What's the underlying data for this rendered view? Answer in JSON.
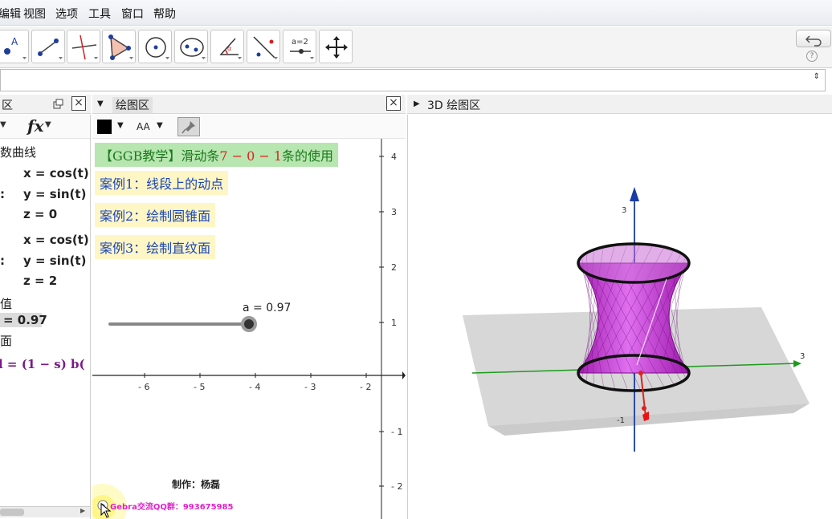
{
  "menu": [
    "编辑",
    "视图",
    "选项",
    "工具",
    "窗口",
    "帮助"
  ],
  "input": {
    "spinner": "⇕"
  },
  "algebra": {
    "header_title": "区",
    "fx_label": "fx",
    "lines": [
      {
        "text": "数曲线",
        "bold": false
      },
      {
        "text": "x = cos(t)",
        "bold": true
      },
      {
        "text": "y = sin(t)",
        "bold": true
      },
      {
        "text": "z = 0",
        "bold": true
      },
      {
        "text": "x = cos(t)",
        "bold": true
      },
      {
        "text": "y = sin(t)",
        "bold": true
      },
      {
        "text": "z = 2",
        "bold": true
      },
      {
        "text": "值",
        "bold": false
      },
      {
        "text": "= 0.97",
        "bold": true
      },
      {
        "text": "面",
        "bold": false
      },
      {
        "text": "l = (1 − s) b(",
        "bold": true
      }
    ],
    "side_marks": [
      ":",
      ":"
    ]
  },
  "graphics": {
    "header_title": "绘图区",
    "style": {
      "fill_color": "#000000",
      "text_style": "AA"
    },
    "title_text_a": "【GGB教学】滑动条",
    "title_text_b": "7 − 0 − 1",
    "title_text_c": "条的使用",
    "cases": [
      "案例1：线段上的动点",
      "案例2：绘制圆锥面",
      "案例3：绘制直纹面"
    ],
    "slider": {
      "label": "a = 0.97",
      "value": 0.97
    },
    "x_ticks": [
      "- 6",
      "- 5",
      "- 4",
      "- 3",
      "- 2"
    ],
    "y_ticks": [
      "4",
      "3",
      "2",
      "1",
      "- 1",
      "- 2"
    ],
    "author": "制作：杨磊",
    "qq": "Gebra交流QQ群：993675985"
  },
  "graphics3d": {
    "header_title": "3D 绘图区",
    "z_ticks": [
      "3",
      "-1"
    ],
    "x_ticks": [
      "3"
    ],
    "surface_color": "#c030c8"
  },
  "colors": {
    "accent_blue": "#1a46b8",
    "title_green": "#1e7a1e",
    "purple": "#7a1a8a"
  }
}
